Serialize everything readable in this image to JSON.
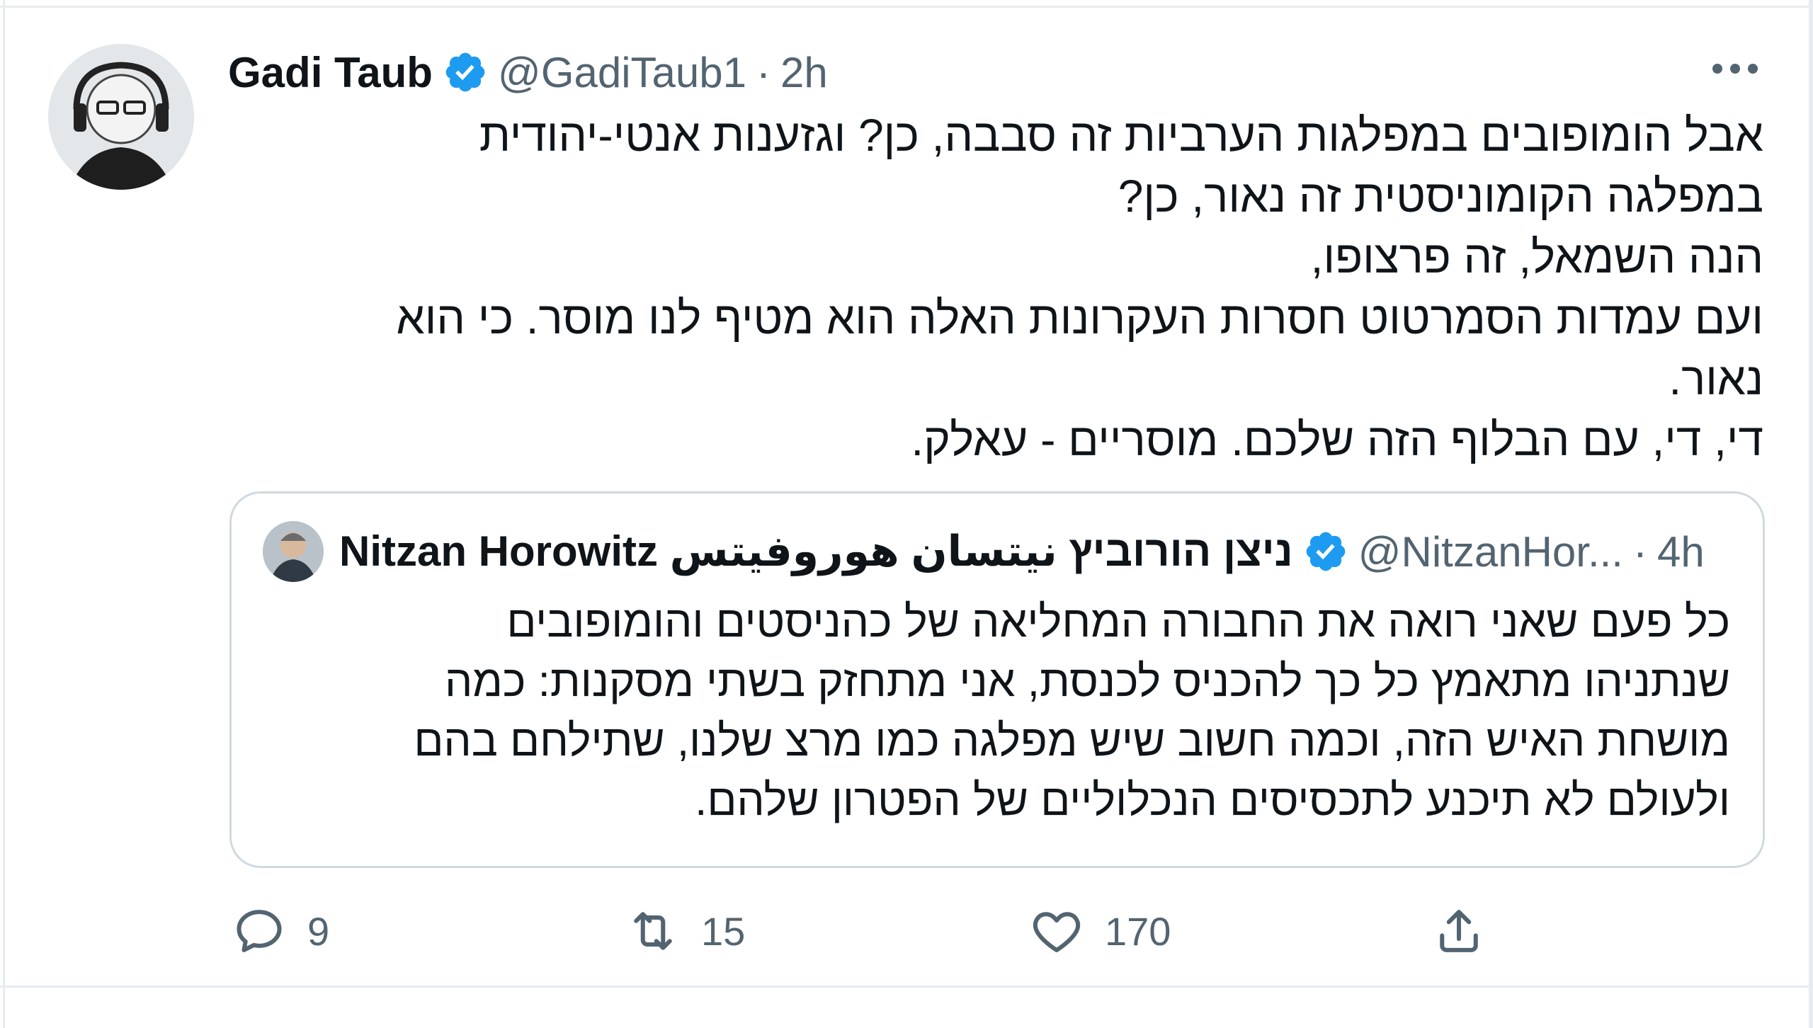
{
  "tweet": {
    "author": {
      "name": "Gadi Taub",
      "handle": "@GadiTaub1",
      "separator": "·",
      "time": "2h",
      "avatar_icon": "profile-photo",
      "verified_icon": "verified-badge-icon"
    },
    "more_icon": "more-dots-icon",
    "text_lines": [
      "אבל הומופובים במפלגות הערביות זה סבבה, כן? וגזענות אנטי-יהודית",
      "במפלגה הקומוניסטית זה נאור, כן?",
      "הנה השמאל, זה פרצופו,",
      "ועם עמדות הסמרטוט חסרות העקרונות האלה הוא מטיף לנו מוסר. כי הוא",
      "נאור.",
      "די, די, עם הבלוף הזה שלכם. מוסריים - עאלק."
    ],
    "quoted": {
      "name": "Nitzan Horowitz ניצן הורוביץ نيتسان هوروفيتس",
      "handle": "@NitzanHor...",
      "separator": "·",
      "time": "4h",
      "text_lines": [
        "כל פעם שאני רואה את החבורה המחליאה של כהניסטים והומופובים",
        "שנתניהו מתאמץ כל כך להכניס לכנסת, אני מתחזק בשתי מסקנות: כמה",
        "מושחת האיש הזה, וכמה חשוב שיש מפלגה כמו מרצ שלנו, שתילחם בהם",
        "ולעולם לא תיכנע לתכסיסים הנכלוליים  של הפטרון שלהם."
      ]
    },
    "actions": {
      "reply_count": "9",
      "retweet_count": "15",
      "like_count": "170",
      "reply_icon": "reply-icon",
      "retweet_icon": "retweet-icon",
      "like_icon": "heart-icon",
      "share_icon": "share-icon"
    }
  },
  "colors": {
    "text": "#0f1419",
    "muted": "#536471",
    "verified": "#1d9bf0",
    "border": "#cfd9de"
  }
}
